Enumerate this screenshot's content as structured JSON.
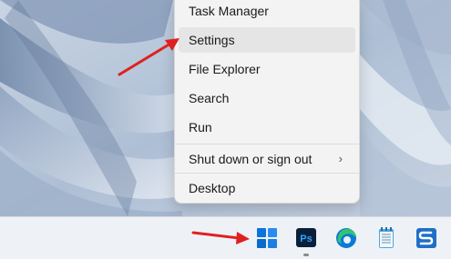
{
  "context_menu": {
    "items": [
      {
        "label": "Task Manager"
      },
      {
        "label": "Settings"
      },
      {
        "label": "File Explorer"
      },
      {
        "label": "Search"
      },
      {
        "label": "Run"
      },
      {
        "label": "Shut down or sign out"
      },
      {
        "label": "Desktop"
      }
    ],
    "submenu_glyph": "›",
    "hovered_item": "Settings"
  },
  "taskbar": {
    "photoshop_label": "Ps",
    "pinned": [
      "windows-start-icon",
      "photoshop-icon",
      "edge-icon",
      "notepad-icon",
      "snagit-icon"
    ]
  },
  "annotation": {
    "arrow_color": "#e02020"
  },
  "colors": {
    "menu_bg": "#f3f3f3",
    "menu_hover": "#e5e5e5",
    "taskbar_bg": "#eef2f7",
    "windows_blue": "#0a74da"
  }
}
